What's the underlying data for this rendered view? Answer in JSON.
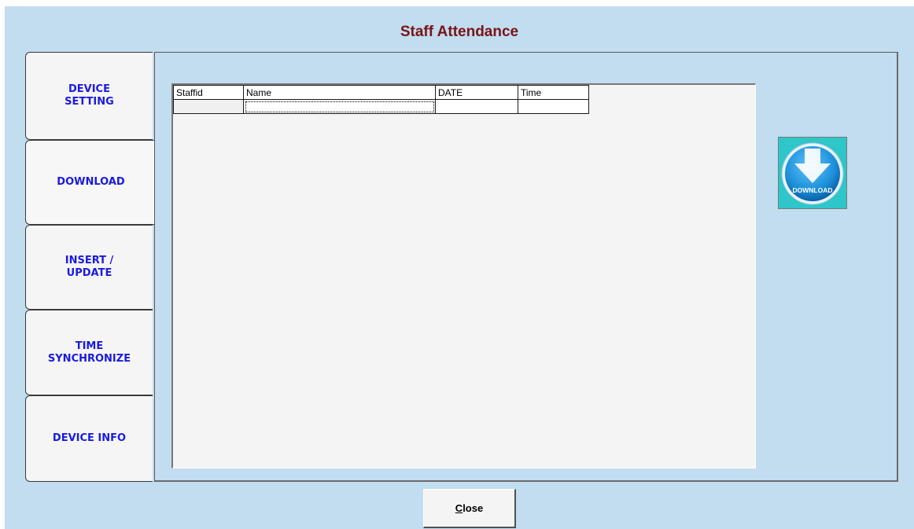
{
  "window": {
    "title": "Staff Attendance"
  },
  "tabs": [
    {
      "label": "DEVICE\nSETTING"
    },
    {
      "label": "DOWNLOAD"
    },
    {
      "label": "INSERT /\nUPDATE"
    },
    {
      "label": "TIME\nSYNCHRONIZE"
    },
    {
      "label": "DEVICE INFO"
    }
  ],
  "active_tab": "DOWNLOAD",
  "grid": {
    "columns": [
      "Staffid",
      "Name",
      "DATE",
      "Time"
    ],
    "rows": [
      [
        "",
        "",
        "",
        ""
      ]
    ]
  },
  "download_button": {
    "label": "DOWNLOAD",
    "icon": "download-arrow-icon"
  },
  "close_button": {
    "label_mnemonic": "C",
    "label_rest": "lose"
  },
  "colors": {
    "background": "#c2dcf0",
    "title": "#7a1414",
    "tab_text": "#1a1ae0",
    "download_bg": "#2ec6c8",
    "download_circle": "#1c8fd8"
  }
}
